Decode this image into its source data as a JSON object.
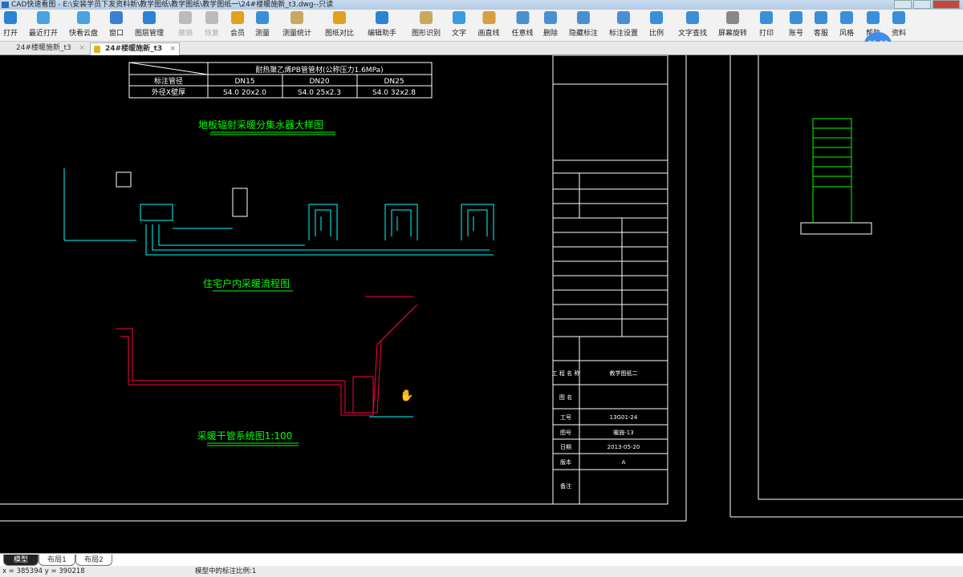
{
  "window": {
    "title": "CAD快速看图 - E:\\安装学员下发资料新\\教学图纸\\教学图纸\\教学图纸一\\24#楼暖施新_t3.dwg--只读"
  },
  "toolbar": [
    {
      "label": "打开",
      "icon": "folder-icon",
      "color": "#2a84d2",
      "enabled": true
    },
    {
      "label": "最近打开",
      "icon": "clock-icon",
      "color": "#4aa3e0",
      "enabled": true
    },
    {
      "label": "快看云盘",
      "icon": "cloud-icon",
      "color": "#4aa3e0",
      "enabled": true
    },
    {
      "label": "窗口",
      "icon": "window-icon",
      "color": "#3a7fd0",
      "enabled": true
    },
    {
      "label": "图层管理",
      "icon": "layers-icon",
      "color": "#2a84d2",
      "enabled": true
    },
    {
      "label": "撤销",
      "icon": "undo-icon",
      "color": "#bbbbbb",
      "enabled": false
    },
    {
      "label": "恢复",
      "icon": "redo-icon",
      "color": "#bbbbbb",
      "enabled": false
    },
    {
      "label": "会员",
      "icon": "vip-icon",
      "color": "#e0a020",
      "enabled": true
    },
    {
      "label": "测量",
      "icon": "ruler-icon",
      "color": "#3a8fd8",
      "enabled": true
    },
    {
      "label": "测量统计",
      "icon": "measure-stats-icon",
      "color": "#c9a860",
      "enabled": true
    },
    {
      "label": "图纸对比",
      "icon": "compare-icon",
      "color": "#e0a020",
      "enabled": true
    },
    {
      "label": "编辑助手",
      "icon": "edit-assistant-icon",
      "color": "#2a84d2",
      "enabled": true
    },
    {
      "label": "图形识别",
      "icon": "shape-recognition-icon",
      "color": "#c9a860",
      "enabled": true
    },
    {
      "label": "文字",
      "icon": "text-icon",
      "color": "#3a9be0",
      "enabled": true
    },
    {
      "label": "画直线",
      "icon": "line-icon",
      "color": "#d4a040",
      "enabled": true
    },
    {
      "label": "任意线",
      "icon": "pen-icon",
      "color": "#4a90d0",
      "enabled": true
    },
    {
      "label": "删除",
      "icon": "eraser-icon",
      "color": "#4a90d0",
      "enabled": true
    },
    {
      "label": "隐藏标注",
      "icon": "hide-icon",
      "color": "#4a90d0",
      "enabled": true
    },
    {
      "label": "标注设置",
      "icon": "annotation-settings-icon",
      "color": "#4a90d0",
      "enabled": true
    },
    {
      "label": "比例",
      "icon": "scale-icon",
      "color": "#3a8fd8",
      "enabled": true
    },
    {
      "label": "文字查找",
      "icon": "text-search-icon",
      "color": "#3a8fd8",
      "enabled": true
    },
    {
      "label": "屏幕旋转",
      "icon": "rotate-screen-icon",
      "color": "#888888",
      "enabled": true
    },
    {
      "label": "打印",
      "icon": "print-icon",
      "color": "#3a8fd8",
      "enabled": true
    },
    {
      "label": "账号",
      "icon": "user-icon",
      "color": "#3a8fd8",
      "enabled": true
    },
    {
      "label": "客服",
      "icon": "headset-icon",
      "color": "#3a8fd8",
      "enabled": true
    },
    {
      "label": "风格",
      "icon": "style-icon",
      "color": "#3a8fd8",
      "enabled": true
    },
    {
      "label": "帮助",
      "icon": "info-icon",
      "color": "#3a8fd8",
      "enabled": true
    },
    {
      "label": "资料",
      "icon": "documents-icon",
      "color": "#3a8fd8",
      "enabled": true
    }
  ],
  "timer": "00:00",
  "tabs": [
    {
      "label": "24#楼暖施新_t3",
      "active": false
    },
    {
      "label": "24#楼暖施新_t3",
      "active": true
    }
  ],
  "drawing": {
    "table": {
      "header": "耐热聚乙烯PB管管材(公称压力1.6MPa)",
      "row1_label": "标注管径",
      "row2_label": "外径X壁厚",
      "cols": [
        "DN15",
        "DN20",
        "DN25"
      ],
      "specs": [
        "S4.0 20x2.0",
        "S4.0 25x2.3",
        "S4.0 32x2.8"
      ]
    },
    "titles": {
      "manifold": "地板辐射采暖分集水器大样图",
      "flow": "住宅户内采暖流程图",
      "system": "采暖干管系统图1:100"
    },
    "titleblock": {
      "project_label": "工 程 名 称",
      "project": "教学图纸二",
      "drawing_label": "图 名",
      "job_no_label": "工号",
      "job_no": "13G01-24",
      "drawing_no_label": "图号",
      "drawing_no": "暖施-13",
      "date_label": "日期",
      "date": "2013-05-20",
      "version_label": "版本",
      "version": "A",
      "remarks_label": "备注"
    }
  },
  "layout_tabs": [
    {
      "label": "模型",
      "active": true
    },
    {
      "label": "布局1",
      "active": false
    },
    {
      "label": "布局2",
      "active": false
    }
  ],
  "status": {
    "coords": "x = 385394  y = 390218",
    "scale": "模型中的标注比例:1"
  },
  "colors": {
    "canvas": "#000000",
    "pipe_cyan": "#00ffff",
    "pipe_red": "#ff0040",
    "title_green": "#00ff00",
    "accent": "#2a84d2"
  }
}
